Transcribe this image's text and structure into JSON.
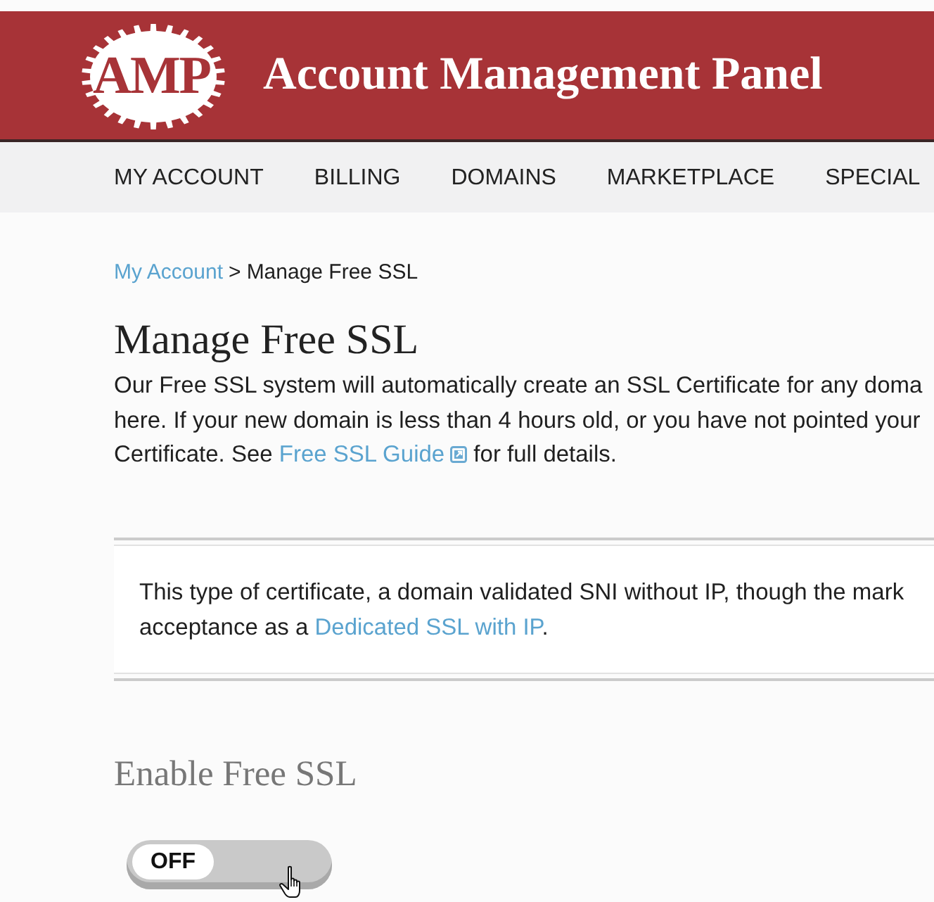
{
  "header": {
    "logo": "AMP",
    "title": "Account Management Panel"
  },
  "nav": [
    "MY ACCOUNT",
    "BILLING",
    "DOMAINS",
    "MARKETPLACE",
    "SPECIAL"
  ],
  "breadcrumb": {
    "items": [
      {
        "label": "My Account",
        "kind": "link"
      },
      {
        "label": "Manage Free SSL",
        "kind": "current"
      }
    ],
    "separator": ">"
  },
  "page_title": "Manage Free SSL",
  "intro": {
    "lines": [
      [
        {
          "kind": "text",
          "text": "Our Free SSL system will automatically create an SSL Certificate for any doma"
        }
      ],
      [
        {
          "kind": "text",
          "text": "here. If your new domain is less than 4 hours old, or you have not pointed your"
        }
      ],
      [
        {
          "kind": "text",
          "text": "Certificate. See "
        },
        {
          "kind": "link",
          "text": "Free SSL Guide",
          "external": true
        },
        {
          "kind": "text",
          "text": " for full details."
        }
      ]
    ]
  },
  "notice": {
    "lines": [
      [
        {
          "kind": "text",
          "text": "This type of certificate, a domain validated SNI without IP, though the mark"
        }
      ],
      [
        {
          "kind": "text",
          "text": "acceptance as a "
        },
        {
          "kind": "link",
          "text": "Dedicated SSL with IP",
          "external": false
        },
        {
          "kind": "text",
          "text": "."
        }
      ]
    ]
  },
  "section_title": "Enable Free SSL",
  "ssl_toggle": {
    "label": "OFF",
    "on": false
  }
}
